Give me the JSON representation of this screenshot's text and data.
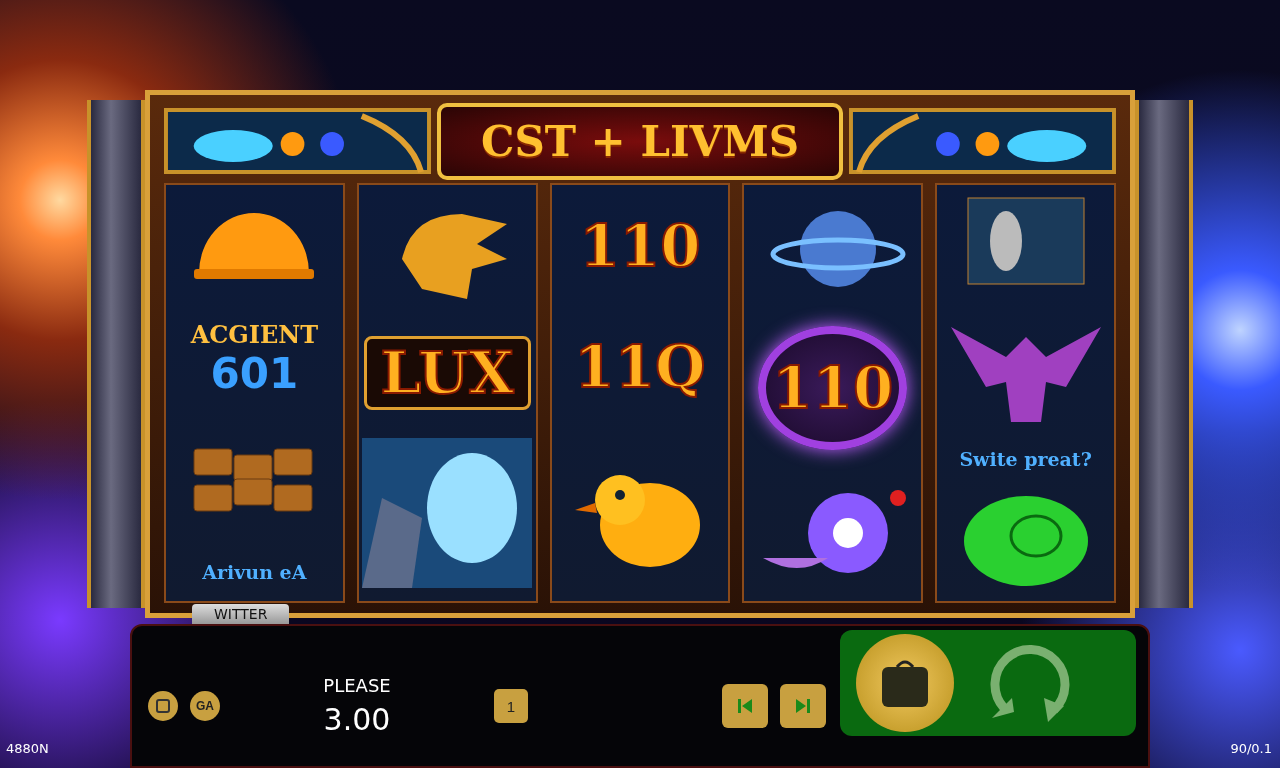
{
  "title": "CST + LIVMS",
  "reels": [
    {
      "symbols": [
        {
          "kind": "dome"
        },
        {
          "kind": "logo",
          "lines": [
            "ACGIENT",
            "601"
          ]
        },
        {
          "kind": "bricks"
        },
        {
          "kind": "caption",
          "text": "Arivun eA"
        }
      ]
    },
    {
      "symbols": [
        {
          "kind": "head"
        },
        {
          "kind": "badge",
          "text": "LUX"
        },
        {
          "kind": "crystal"
        }
      ]
    },
    {
      "symbols": [
        {
          "kind": "number",
          "text": "110"
        },
        {
          "kind": "number",
          "text": "11Q"
        },
        {
          "kind": "duck"
        }
      ]
    },
    {
      "symbols": [
        {
          "kind": "planet"
        },
        {
          "kind": "ring",
          "text": "110"
        },
        {
          "kind": "orb"
        }
      ]
    },
    {
      "symbols": [
        {
          "kind": "moon"
        },
        {
          "kind": "creature"
        },
        {
          "kind": "caption",
          "text": "Swite preat?"
        },
        {
          "kind": "gem"
        }
      ]
    }
  ],
  "panel": {
    "tab": "WITTER",
    "label": "PLEASE",
    "value": "3.00",
    "coin_buttons": [
      {
        "kind": "icon"
      },
      {
        "kind": "text",
        "text": "GA"
      }
    ],
    "lines_button": "1"
  },
  "corner_left": "4880N",
  "corner_right": "90/0.1"
}
